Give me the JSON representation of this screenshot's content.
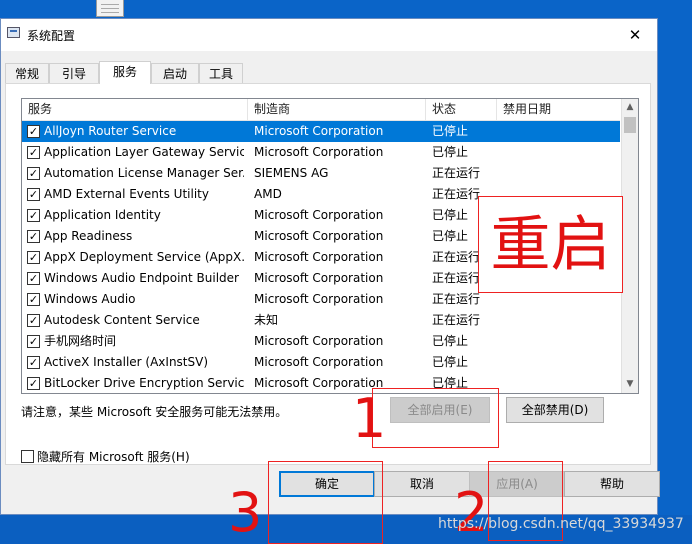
{
  "window": {
    "title": "系统配置",
    "close_glyph": "✕"
  },
  "tabs": [
    "常规",
    "引导",
    "服务",
    "启动",
    "工具"
  ],
  "active_tab": "服务",
  "table": {
    "columns": [
      "服务",
      "制造商",
      "状态",
      "禁用日期"
    ],
    "rows": [
      {
        "service": "AllJoyn Router Service",
        "manufacturer": "Microsoft Corporation",
        "status": "已停止",
        "date": "",
        "checked": true,
        "selected": true
      },
      {
        "service": "Application Layer Gateway Service",
        "manufacturer": "Microsoft Corporation",
        "status": "已停止",
        "date": "",
        "checked": true
      },
      {
        "service": "Automation License Manager Ser...",
        "manufacturer": "SIEMENS AG",
        "status": "正在运行",
        "date": "",
        "checked": true
      },
      {
        "service": "AMD External Events Utility",
        "manufacturer": "AMD",
        "status": "正在运行",
        "date": "",
        "checked": true
      },
      {
        "service": "Application Identity",
        "manufacturer": "Microsoft Corporation",
        "status": "已停止",
        "date": "",
        "checked": true
      },
      {
        "service": "App Readiness",
        "manufacturer": "Microsoft Corporation",
        "status": "已停止",
        "date": "",
        "checked": true
      },
      {
        "service": "AppX Deployment Service (AppX...",
        "manufacturer": "Microsoft Corporation",
        "status": "正在运行",
        "date": "",
        "checked": true
      },
      {
        "service": "Windows Audio Endpoint Builder",
        "manufacturer": "Microsoft Corporation",
        "status": "正在运行",
        "date": "",
        "checked": true
      },
      {
        "service": "Windows Audio",
        "manufacturer": "Microsoft Corporation",
        "status": "正在运行",
        "date": "",
        "checked": true
      },
      {
        "service": "Autodesk Content Service",
        "manufacturer": "未知",
        "status": "正在运行",
        "date": "",
        "checked": true
      },
      {
        "service": "手机网络时间",
        "manufacturer": "Microsoft Corporation",
        "status": "已停止",
        "date": "",
        "checked": true
      },
      {
        "service": "ActiveX Installer (AxInstSV)",
        "manufacturer": "Microsoft Corporation",
        "status": "已停止",
        "date": "",
        "checked": true
      },
      {
        "service": "BitLocker Drive Encryption Service",
        "manufacturer": "Microsoft Corporation",
        "status": "已停止",
        "date": "",
        "checked": true
      }
    ]
  },
  "note": "请注意，某些 Microsoft 安全服务可能无法禁用。",
  "buttons": {
    "enable_all": "全部启用(E)",
    "disable_all": "全部禁用(D)",
    "ok": "确定",
    "cancel": "取消",
    "apply": "应用(A)",
    "help": "帮助"
  },
  "hide_ms_label": "隐藏所有 Microsoft 服务(H)",
  "annotations": {
    "restart": "重启",
    "n1": "1",
    "n2": "2",
    "n3": "3"
  },
  "watermark": "https://blog.csdn.net/qq_33934937",
  "colors": {
    "selection": "#0078d7",
    "annotation": "#e21212",
    "desktop": "#0a64c8"
  },
  "icons": {
    "checkbox": "check-icon",
    "scroll_up": "chevron-up-icon",
    "scroll_down": "chevron-down-icon"
  }
}
